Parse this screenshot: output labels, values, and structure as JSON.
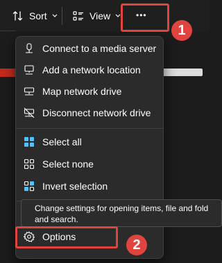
{
  "toolbar": {
    "sort_label": "Sort",
    "view_label": "View",
    "more_label": "•••"
  },
  "menu": {
    "items": [
      {
        "label": "Connect to a media server",
        "icon": "media-server-icon"
      },
      {
        "label": "Add a network location",
        "icon": "network-location-icon"
      },
      {
        "label": "Map network drive",
        "icon": "map-drive-icon"
      },
      {
        "label": "Disconnect network drive",
        "icon": "disconnect-drive-icon"
      },
      {
        "label": "Select all",
        "icon": "select-all-icon"
      },
      {
        "label": "Select none",
        "icon": "select-none-icon"
      },
      {
        "label": "Invert selection",
        "icon": "invert-selection-icon"
      },
      {
        "label": "Options",
        "icon": "gear-icon"
      }
    ]
  },
  "tooltip": {
    "line1": "Change settings for opening items, file and fold",
    "line2": "and search."
  },
  "annotations": {
    "badge_1": "1",
    "badge_2": "2",
    "highlight_color": "#e0443e"
  },
  "colors": {
    "menu_bg": "#2b2b2b",
    "toolbar_bg": "#1f1f1f",
    "accent_blue": "#4cc2ff"
  }
}
